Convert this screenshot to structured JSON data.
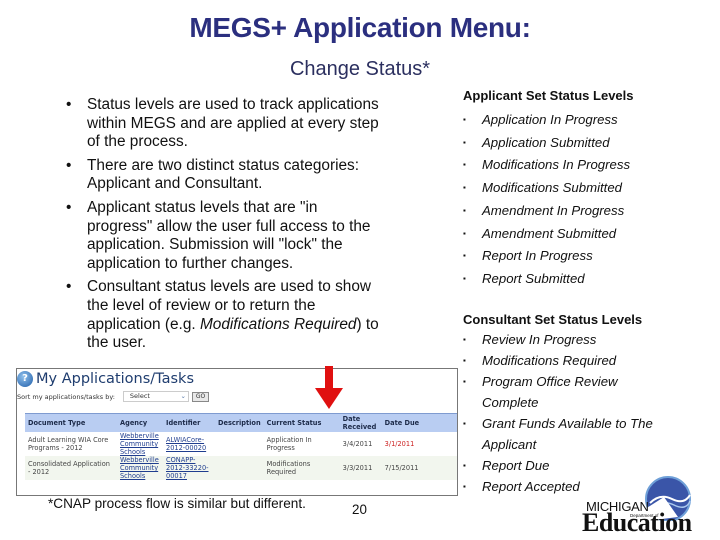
{
  "title": "MEGS+ Application Menu:",
  "subtitle": "Change Status*",
  "bullets": [
    {
      "text": "Status levels are used to track applications within MEGS and are applied at every step of the process."
    },
    {
      "text": "There are two distinct status categories: Applicant and Consultant."
    },
    {
      "text": "Applicant status levels that are \"in progress\" allow the user full access to the application.  Submission will \"lock\" the application to further changes."
    },
    {
      "text_before": "Consultant status levels are used to show the level of review or to return the application (e.g. ",
      "text_italic": "Modifications Required",
      "text_after": ") to the user."
    }
  ],
  "applicant_levels": {
    "heading": "Applicant Set Status Levels",
    "items": [
      "Application In Progress",
      "Application Submitted",
      "Modifications In Progress",
      "Modifications Submitted",
      "Amendment In Progress",
      "Amendment Submitted",
      "Report In Progress",
      "Report Submitted"
    ]
  },
  "consultant_levels": {
    "heading": "Consultant Set Status Levels",
    "items": [
      "Review In Progress",
      "Modifications Required",
      "Program Office Review Complete",
      "Grant Funds Available to The Applicant",
      "Report Due",
      "Report Accepted"
    ]
  },
  "screenshot": {
    "icon": "info-globe-icon",
    "title": "My Applications/Tasks",
    "sort_label": "Sort my applications/tasks by:",
    "sort_value": "Select",
    "go_label": "GO",
    "columns": [
      "Document Type",
      "Agency",
      "Identifier",
      "Description",
      "Current Status",
      "Date Received",
      "Date Due"
    ],
    "rows": [
      {
        "document_type": "Adult Learning WIA Core Programs - 2012",
        "agency": "Webberville Community Schools",
        "identifier": "ALWIACore-2012-00020",
        "description": "",
        "status": "Application In Progress",
        "date_received": "3/4/2011",
        "date_due": "3/1/2011"
      },
      {
        "document_type": "Consolidated Application - 2012",
        "agency": "Webberville Community Schools",
        "identifier": "CONAPP-2012-33220-00017",
        "description": "",
        "status": "Modifications Required",
        "date_received": "3/3/2011",
        "date_due": "7/15/2011"
      }
    ],
    "arrow_color": "#e01010"
  },
  "footnote": "*CNAP process flow is similar but different.",
  "page_number": "20",
  "logo": {
    "line1": "MICHIGAN",
    "line2": "Department of",
    "line3": "Education"
  },
  "colors": {
    "title": "#2b2f7f",
    "header_row": "#b9cdf2",
    "overdue": "#cc2222"
  }
}
